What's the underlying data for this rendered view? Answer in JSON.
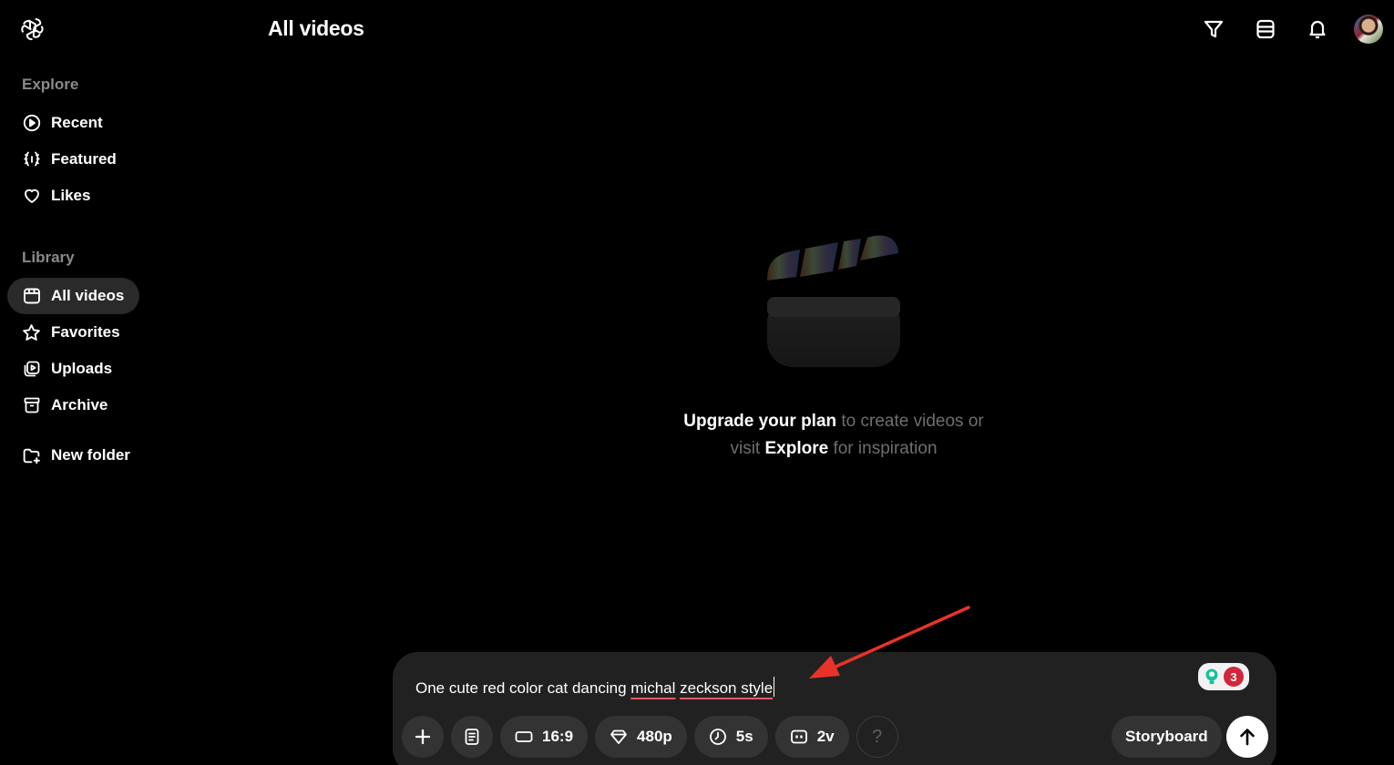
{
  "header": {
    "title": "All videos",
    "actions": [
      {
        "name": "filter-button",
        "icon": "filter-icon"
      },
      {
        "name": "view-toggle-button",
        "icon": "list-view-icon"
      },
      {
        "name": "notifications-button",
        "icon": "bell-icon"
      }
    ]
  },
  "sidebar": {
    "explore_label": "Explore",
    "explore_items": [
      {
        "label": "Recent",
        "icon": "play-circle-icon"
      },
      {
        "label": "Featured",
        "icon": "laurel-icon"
      },
      {
        "label": "Likes",
        "icon": "heart-icon"
      }
    ],
    "library_label": "Library",
    "library_items": [
      {
        "label": "All videos",
        "icon": "video-frame-icon",
        "active": true
      },
      {
        "label": "Favorites",
        "icon": "star-icon"
      },
      {
        "label": "Uploads",
        "icon": "upload-video-icon"
      },
      {
        "label": "Archive",
        "icon": "archive-icon"
      }
    ],
    "new_folder_label": "New folder"
  },
  "empty_state": {
    "part1": "Upgrade your plan",
    "part2": " to create videos or",
    "part3": "visit ",
    "part4": "Explore",
    "part5": " for inspiration"
  },
  "composer": {
    "prompt_plain": "One cute red color cat dancing ",
    "prompt_misspelled_1": "michal",
    "prompt_space": " ",
    "prompt_misspelled_2": "zeckson style",
    "grammar_count": "3",
    "options": {
      "aspect_ratio": "16:9",
      "resolution": "480p",
      "duration": "5s",
      "variations": "2v",
      "help": "?"
    },
    "storyboard_label": "Storyboard"
  },
  "colors": {
    "background": "#000000",
    "composer_bg": "#212121",
    "chip_bg": "#333333",
    "annotation_arrow": "#e8332a",
    "spell_underline": "#e45b6a"
  }
}
